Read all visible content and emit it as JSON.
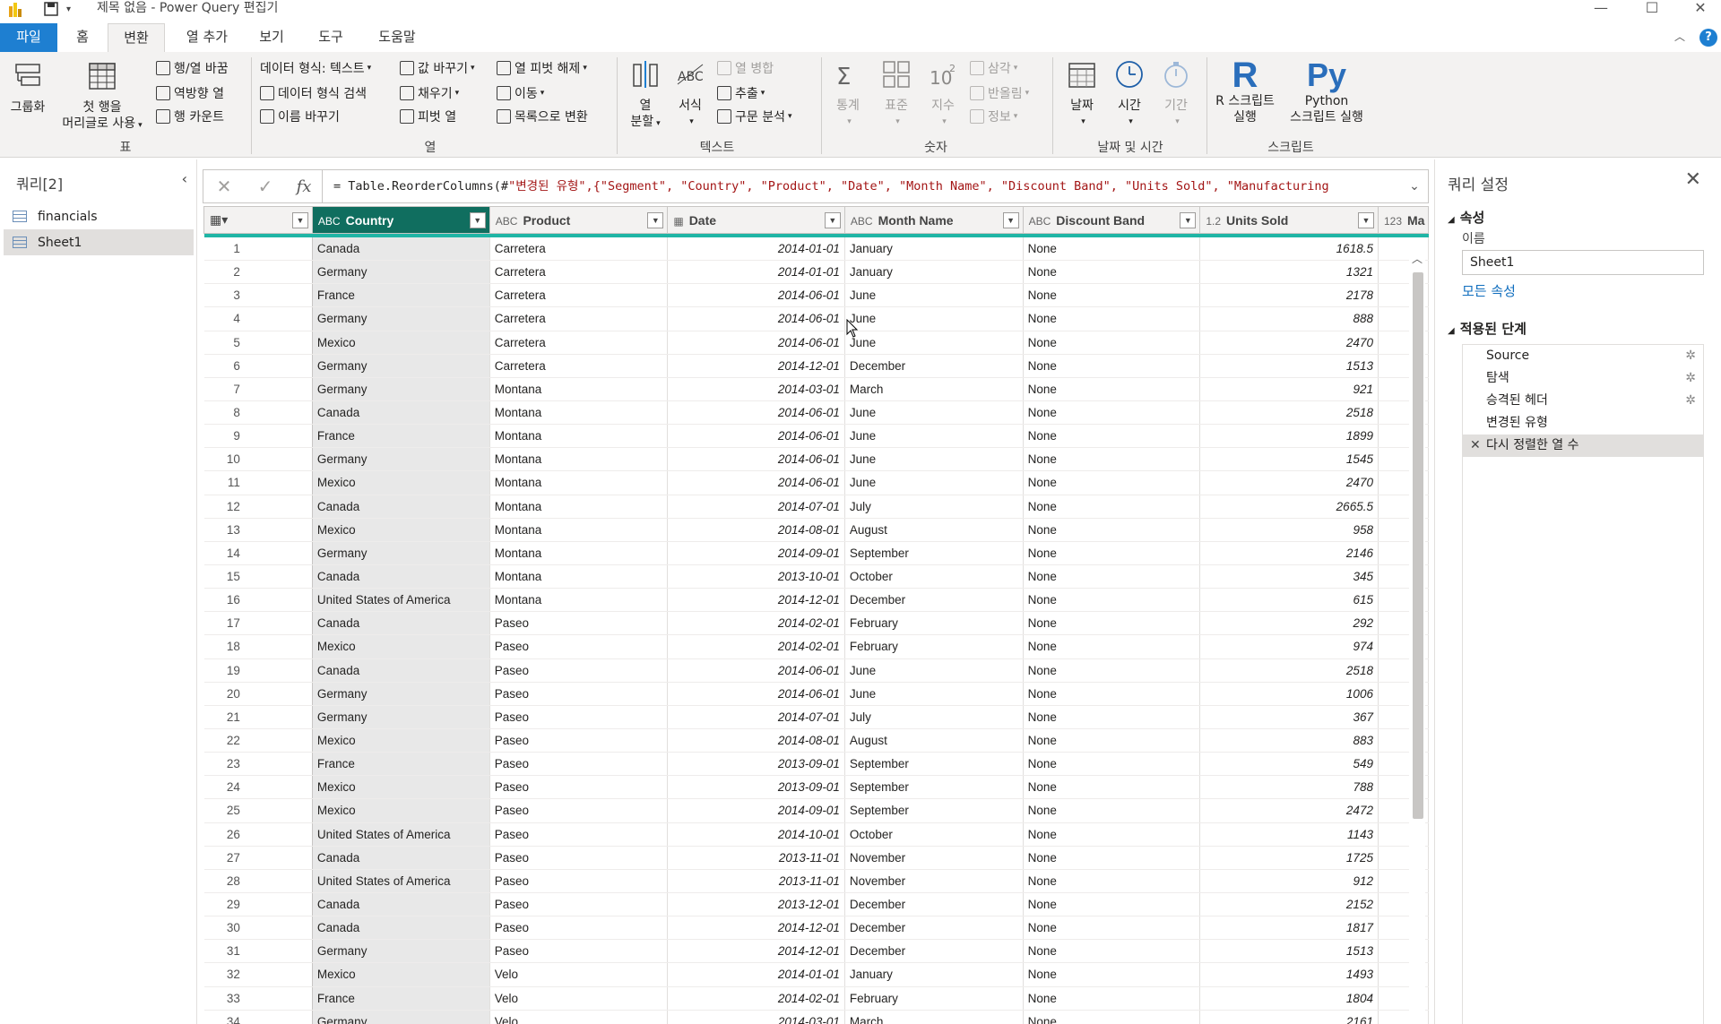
{
  "window": {
    "title": "제목 없음 - Power Query 편집기",
    "minimize_icon": "—",
    "maximize_icon": "☐",
    "close_icon": "✕"
  },
  "menu": [
    "파일",
    "홈",
    "변환",
    "열 추가",
    "보기",
    "도구",
    "도움말"
  ],
  "ribbon": {
    "group_by": "그룹화",
    "first_row_header": [
      "첫 행을",
      "머리글로 사용"
    ],
    "transpose": "행/열 바꿈",
    "reverse_rows": "역방향 열",
    "count_rows": "행 카운트",
    "table_group": "표",
    "data_type": "데이터 형식: 텍스트",
    "detect_type": "데이터 형식 검색",
    "rename": "이름 바꾸기",
    "replace_values": "값 바꾸기",
    "fill": "채우기",
    "pivot": "피벗 열",
    "unpivot": "열 피벗 해제",
    "move": "이동",
    "to_list": "목록으로 변환",
    "column_group": "열",
    "split": [
      "열",
      "분할"
    ],
    "format": "서식",
    "merge": "열 병합",
    "extract": "추출",
    "parse": "구문 분석",
    "text_group": "텍스트",
    "stats": "통계",
    "standard": "표준",
    "scientific": "지수",
    "trig": "삼각",
    "rounding": "반올림",
    "info": "정보",
    "number_group": "숫자",
    "date": "날짜",
    "time": "시간",
    "duration": "기간",
    "datetime_group": "날짜 및 시간",
    "r_script": [
      "R 스크립트",
      "실행"
    ],
    "python_script": [
      "Python",
      "스크립트 실행"
    ],
    "r_label": "R",
    "py_label": "Py",
    "script_group": "스크립트"
  },
  "queries": {
    "header": "쿼리[2]",
    "items": [
      "financials",
      "Sheet1"
    ]
  },
  "formula": {
    "prefix": "= Table.ReorderColumns(#",
    "text": "\"변경된 유형\",{\"Segment\", \"Country\", \"Product\", \"Date\", \"Month Name\", \"Discount Band\", \"Units Sold\", \"Manufacturing"
  },
  "grid": {
    "columns": [
      {
        "name": "",
        "type": ""
      },
      {
        "name": "Country",
        "type": "ABC"
      },
      {
        "name": "Product",
        "type": "ABC"
      },
      {
        "name": "Date",
        "type": "▦"
      },
      {
        "name": "Month Name",
        "type": "ABC"
      },
      {
        "name": "Discount Band",
        "type": "ABC"
      },
      {
        "name": "Units Sold",
        "type": "1.2"
      },
      {
        "name": "Ma",
        "type": "123"
      }
    ],
    "rows": [
      [
        "Canada",
        "Carretera",
        "2014-01-01",
        "January",
        "None",
        "1618.5"
      ],
      [
        "Germany",
        "Carretera",
        "2014-01-01",
        "January",
        "None",
        "1321"
      ],
      [
        "France",
        "Carretera",
        "2014-06-01",
        "June",
        "None",
        "2178"
      ],
      [
        "Germany",
        "Carretera",
        "2014-06-01",
        "June",
        "None",
        "888"
      ],
      [
        "Mexico",
        "Carretera",
        "2014-06-01",
        "June",
        "None",
        "2470"
      ],
      [
        "Germany",
        "Carretera",
        "2014-12-01",
        "December",
        "None",
        "1513"
      ],
      [
        "Germany",
        "Montana",
        "2014-03-01",
        "March",
        "None",
        "921"
      ],
      [
        "Canada",
        "Montana",
        "2014-06-01",
        "June",
        "None",
        "2518"
      ],
      [
        "France",
        "Montana",
        "2014-06-01",
        "June",
        "None",
        "1899"
      ],
      [
        "Germany",
        "Montana",
        "2014-06-01",
        "June",
        "None",
        "1545"
      ],
      [
        "Mexico",
        "Montana",
        "2014-06-01",
        "June",
        "None",
        "2470"
      ],
      [
        "Canada",
        "Montana",
        "2014-07-01",
        "July",
        "None",
        "2665.5"
      ],
      [
        "Mexico",
        "Montana",
        "2014-08-01",
        "August",
        "None",
        "958"
      ],
      [
        "Germany",
        "Montana",
        "2014-09-01",
        "September",
        "None",
        "2146"
      ],
      [
        "Canada",
        "Montana",
        "2013-10-01",
        "October",
        "None",
        "345"
      ],
      [
        "United States of America",
        "Montana",
        "2014-12-01",
        "December",
        "None",
        "615"
      ],
      [
        "Canada",
        "Paseo",
        "2014-02-01",
        "February",
        "None",
        "292"
      ],
      [
        "Mexico",
        "Paseo",
        "2014-02-01",
        "February",
        "None",
        "974"
      ],
      [
        "Canada",
        "Paseo",
        "2014-06-01",
        "June",
        "None",
        "2518"
      ],
      [
        "Germany",
        "Paseo",
        "2014-06-01",
        "June",
        "None",
        "1006"
      ],
      [
        "Germany",
        "Paseo",
        "2014-07-01",
        "July",
        "None",
        "367"
      ],
      [
        "Mexico",
        "Paseo",
        "2014-08-01",
        "August",
        "None",
        "883"
      ],
      [
        "France",
        "Paseo",
        "2013-09-01",
        "September",
        "None",
        "549"
      ],
      [
        "Mexico",
        "Paseo",
        "2013-09-01",
        "September",
        "None",
        "788"
      ],
      [
        "Mexico",
        "Paseo",
        "2014-09-01",
        "September",
        "None",
        "2472"
      ],
      [
        "United States of America",
        "Paseo",
        "2014-10-01",
        "October",
        "None",
        "1143"
      ],
      [
        "Canada",
        "Paseo",
        "2013-11-01",
        "November",
        "None",
        "1725"
      ],
      [
        "United States of America",
        "Paseo",
        "2013-11-01",
        "November",
        "None",
        "912"
      ],
      [
        "Canada",
        "Paseo",
        "2013-12-01",
        "December",
        "None",
        "2152"
      ],
      [
        "Canada",
        "Paseo",
        "2014-12-01",
        "December",
        "None",
        "1817"
      ],
      [
        "Germany",
        "Paseo",
        "2014-12-01",
        "December",
        "None",
        "1513"
      ],
      [
        "Mexico",
        "Velo",
        "2014-01-01",
        "January",
        "None",
        "1493"
      ],
      [
        "France",
        "Velo",
        "2014-02-01",
        "February",
        "None",
        "1804"
      ],
      [
        "Germany",
        "Velo",
        "2014-03-01",
        "March",
        "None",
        "2161"
      ]
    ]
  },
  "settings": {
    "header": "쿼리 설정",
    "properties": "속성",
    "name_label": "이름",
    "name_value": "Sheet1",
    "all_properties": "모든 속성",
    "applied_steps": "적용된 단계",
    "steps": [
      {
        "label": "Source",
        "gear": true
      },
      {
        "label": "탐색",
        "gear": true
      },
      {
        "label": "승격된 헤더",
        "gear": true
      },
      {
        "label": "변경된 유형",
        "gear": false
      },
      {
        "label": "다시 정렬한 열 수",
        "gear": false,
        "selected": true
      }
    ]
  }
}
